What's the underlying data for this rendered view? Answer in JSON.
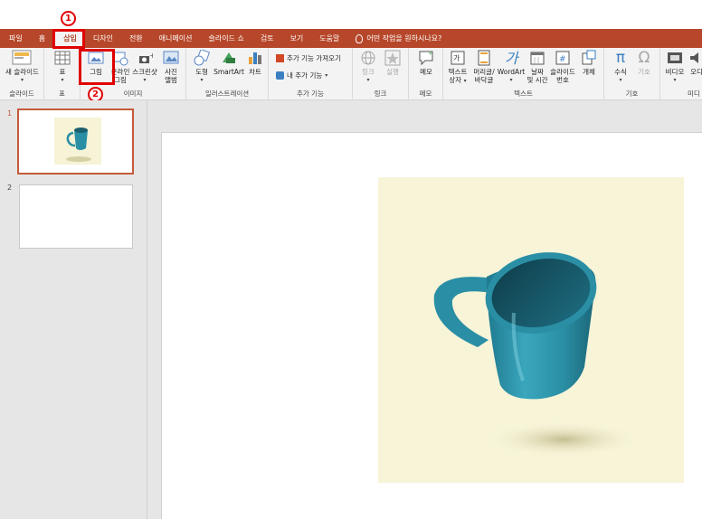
{
  "tabs": [
    "파일",
    "홈",
    "삽입",
    "디자인",
    "전환",
    "애니메이션",
    "슬라이드 쇼",
    "검토",
    "보기",
    "도움말"
  ],
  "search_placeholder": "어떤 작업을 원하시나요?",
  "ribbon": {
    "new_slide": "새 슬라이드",
    "table": "표",
    "picture": "그림",
    "online_picture_1": "온라인",
    "online_picture_2": "그림",
    "screenshot": "스크린샷",
    "photo_album_1": "사진",
    "photo_album_2": "앨범",
    "shapes": "도형",
    "smartart": "SmartArt",
    "chart": "차트",
    "get_addins": "추가 기능 가져오기",
    "my_addins": "내 추가 기능",
    "link": "링크",
    "action": "실행",
    "comment": "메모",
    "textbox_1": "텍스트",
    "textbox_2": "상자",
    "header_footer_1": "머리글/",
    "header_footer_2": "바닥글",
    "wordart": "WordArt",
    "datetime_1": "날짜",
    "datetime_2": "및 시간",
    "slide_number_1": "슬라이드",
    "slide_number_2": "번호",
    "object": "개체",
    "equation": "수식",
    "symbol": "기호",
    "video": "비디오",
    "audio": "오디",
    "groups": {
      "slides": "슬라이드",
      "tables": "표",
      "images": "이미지",
      "illustrations": "일러스트레이션",
      "addins": "추가 기능",
      "links": "링크",
      "comments": "메모",
      "text": "텍스트",
      "symbols": "기호",
      "media": "미디"
    }
  },
  "annotations": {
    "step1": "1",
    "step2": "2"
  },
  "slides": [
    {
      "number": "1"
    },
    {
      "number": "2"
    }
  ],
  "colors": {
    "accent": "#b7472a",
    "highlight": "#e00000",
    "mug": "#2a8fa5"
  }
}
